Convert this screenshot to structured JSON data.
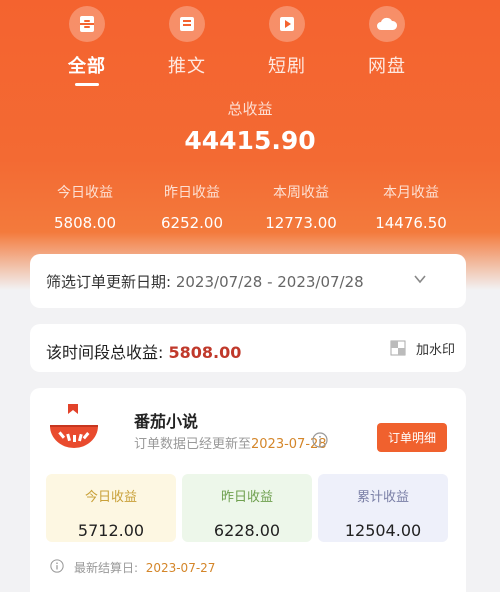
{
  "tabs": [
    {
      "label": "全部",
      "icon": "bucket-icon",
      "active": true
    },
    {
      "label": "推文",
      "icon": "book-icon",
      "active": false
    },
    {
      "label": "短剧",
      "icon": "play-icon",
      "active": false
    },
    {
      "label": "网盘",
      "icon": "cloud-icon",
      "active": false
    }
  ],
  "totals": {
    "label": "总收益",
    "value": "44415.90",
    "stats": [
      {
        "label": "今日收益",
        "value": "5808.00"
      },
      {
        "label": "昨日收益",
        "value": "6252.00"
      },
      {
        "label": "本周收益",
        "value": "12773.00"
      },
      {
        "label": "本月收益",
        "value": "14476.50"
      }
    ]
  },
  "filter": {
    "label": "筛选订单更新日期:",
    "range": "2023/07/28 - 2023/07/28"
  },
  "summary": {
    "label": "该时间段总收益:",
    "value": "5808.00",
    "watermark_label": "加水印"
  },
  "app": {
    "name": "番茄小说",
    "update_prefix": "订单数据已经更新至",
    "update_date": "2023-07-28",
    "order_button": "订单明细",
    "boxes": [
      {
        "label": "今日收益",
        "value": "5712.00"
      },
      {
        "label": "昨日收益",
        "value": "6228.00"
      },
      {
        "label": "累计收益",
        "value": "12504.00"
      }
    ],
    "settle_label": "最新结算日:",
    "settle_date": "2023-07-27"
  },
  "colors": {
    "brand": "#f4632f",
    "accent_value": "#c0392b",
    "date_gold": "#d4862a"
  }
}
